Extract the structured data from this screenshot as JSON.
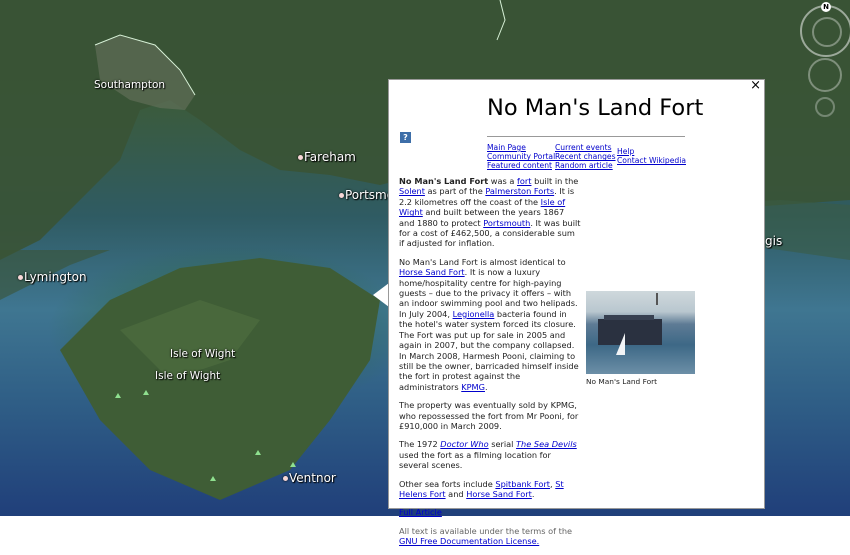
{
  "map": {
    "places": [
      {
        "name": "Southampton"
      },
      {
        "name": "Fareham"
      },
      {
        "name": "Portsmouth_partial",
        "label": "Portsmo"
      },
      {
        "name": "Lymington"
      },
      {
        "name": "Isle of Wight 1",
        "label": "Isle of Wight"
      },
      {
        "name": "Isle of Wight 2",
        "label": "Isle of Wight"
      },
      {
        "name": "Ventnor"
      },
      {
        "name": "Hayling partial",
        "label": "gis"
      }
    ],
    "compass_letter": "N"
  },
  "popup": {
    "close": "×",
    "title": "No Man's Land Fort",
    "help_icon": "?",
    "nav_col1": [
      "Main Page",
      "Community Portal",
      "Featured content"
    ],
    "nav_col2": [
      "Current events",
      "Recent changes",
      "Random article"
    ],
    "nav_col3": [
      "Help",
      "Contact Wikipedia"
    ],
    "p1": {
      "b": "No Man's Land Fort",
      "t1": " was a ",
      "l1": "fort",
      "t2": " built in the ",
      "l2": "Solent",
      "t3": " as part of the ",
      "l3": "Palmerston Forts",
      "t4": ". It is 2.2 kilometres off the coast of the ",
      "l4": "Isle of Wight",
      "t5": " and built between the years 1867 and 1880 to protect ",
      "l5": "Portsmouth",
      "t6": ". It was built for a cost of £462,500, a considerable sum if adjusted for inflation."
    },
    "p2": {
      "t1": "No Man's Land Fort is almost identical to ",
      "l1": "Horse Sand Fort",
      "t2": ". It is now a luxury home/hospitality centre for high-paying guests – due to the privacy it offers – with an indoor swimming pool and two helipads. In July 2004, ",
      "l2": "Legionella",
      "t3": " bacteria found in the hotel's water system forced its closure. The Fort was put up for sale in 2005 and again in 2007, but the company collapsed. In March 2008, Harmesh Pooni, claiming to still be the owner, barricaded himself inside the fort in protest against the administrators ",
      "l3": "KPMG",
      "t4": "."
    },
    "p3": "The property was eventually sold by KPMG, who repossessed the fort from Mr Pooni, for £910,000 in March 2009.",
    "p4": {
      "t1": "The 1972 ",
      "l1": "Doctor Who",
      "t2": " serial ",
      "l2": "The Sea Devils",
      "t3": " used the fort as a filming location for several scenes."
    },
    "p5": {
      "t1": "Other sea forts include ",
      "l1": "Spitbank Fort",
      "t2": ", ",
      "l2": "St Helens Fort",
      "t3": " and ",
      "l3": "Horse Sand Fort",
      "t4": "."
    },
    "full_article": "Full Article",
    "license": {
      "t1": "All text is available under the terms of the ",
      "l1": "GNU Free Documentation License."
    },
    "image_caption": "No Man's Land Fort"
  }
}
